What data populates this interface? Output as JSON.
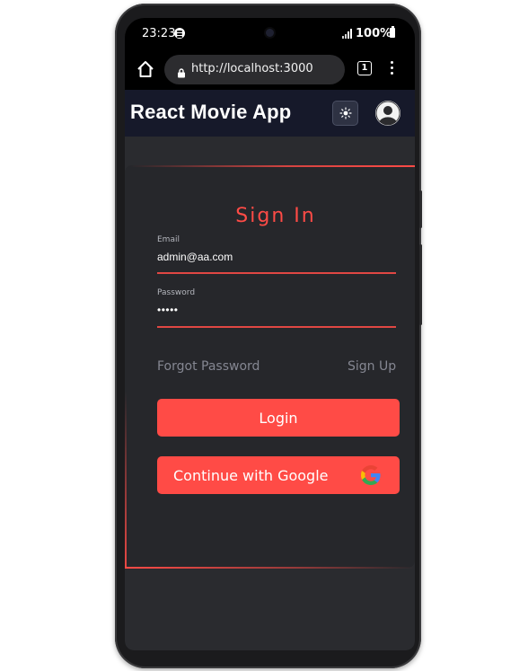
{
  "status_bar": {
    "time": "23:23",
    "battery": "100%"
  },
  "browser": {
    "url": "http://localhost:3000",
    "tab_count": "1"
  },
  "app": {
    "title": "React Movie App"
  },
  "signin": {
    "title": "Sign In",
    "email_label": "Email",
    "email_value": "admin@aa.com",
    "password_label": "Password",
    "password_value": "•••••",
    "forgot_password": "Forgot Password",
    "sign_up": "Sign Up",
    "login_button": "Login",
    "google_button": "Continue with Google"
  },
  "colors": {
    "accent": "#ff4b46",
    "card_bg": "#26272b",
    "navbar_bg": "#16192a"
  },
  "icons": [
    "spotify-icon",
    "signal-icon",
    "battery-icon",
    "home-icon",
    "lock-icon",
    "tabs-icon",
    "kebab-menu-icon",
    "sun-icon",
    "avatar-icon",
    "google-icon"
  ]
}
